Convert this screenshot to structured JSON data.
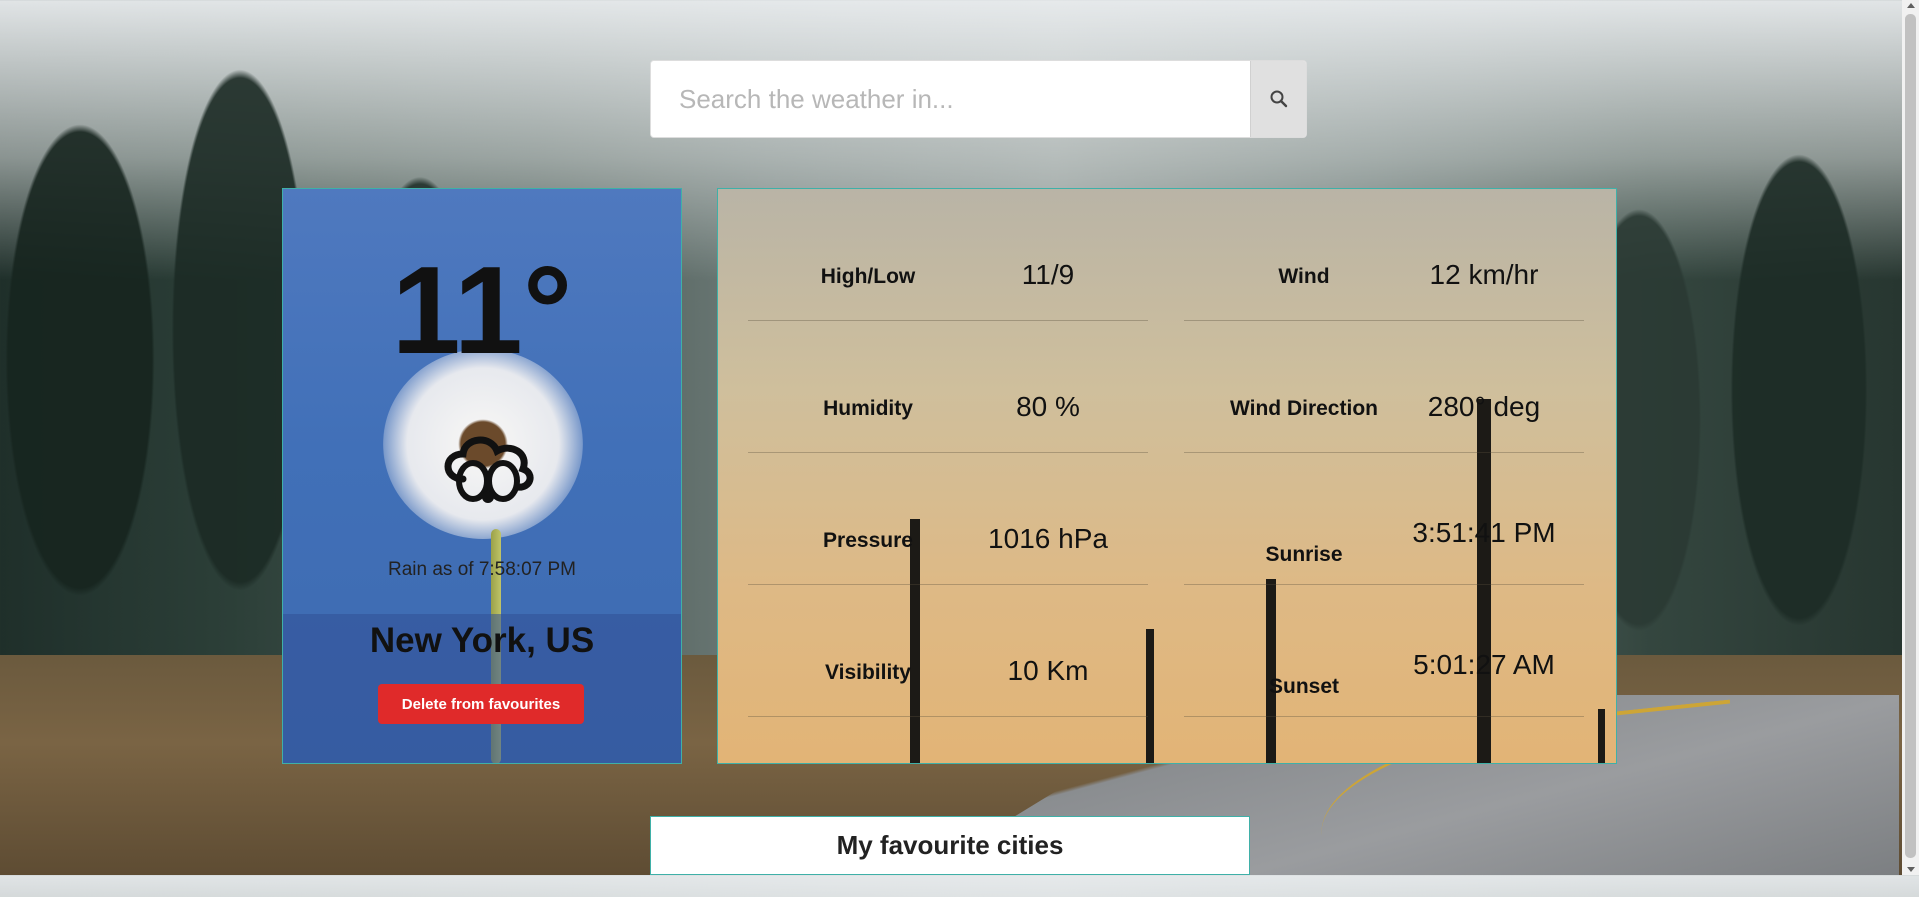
{
  "search": {
    "placeholder": "Search the weather in...",
    "button_icon": "search-icon"
  },
  "current": {
    "temperature": "11°",
    "condition_text": "Rain as of 7:58:07 PM",
    "weather_icon": "rain-cloud-icon",
    "city": "New York, US",
    "delete_label": "Delete from favourites",
    "delete_color": "#e02a2a"
  },
  "details": {
    "left": [
      {
        "label": "High/Low",
        "value": "11/9"
      },
      {
        "label": "Humidity",
        "value": "80 %"
      },
      {
        "label": "Pressure",
        "value": "1016 hPa"
      },
      {
        "label": "Visibility",
        "value": "10 Km"
      }
    ],
    "right": [
      {
        "label": "Wind",
        "value": "12 km/hr"
      },
      {
        "label": "Wind Direction",
        "value": "280° deg"
      },
      {
        "label": "Sunrise",
        "value": "3:51:41 PM"
      },
      {
        "label": "Sunset",
        "value": "5:01:27 AM"
      }
    ]
  },
  "favourites": {
    "title": "My favourite cities"
  },
  "accent_color": "#3fb0a8"
}
